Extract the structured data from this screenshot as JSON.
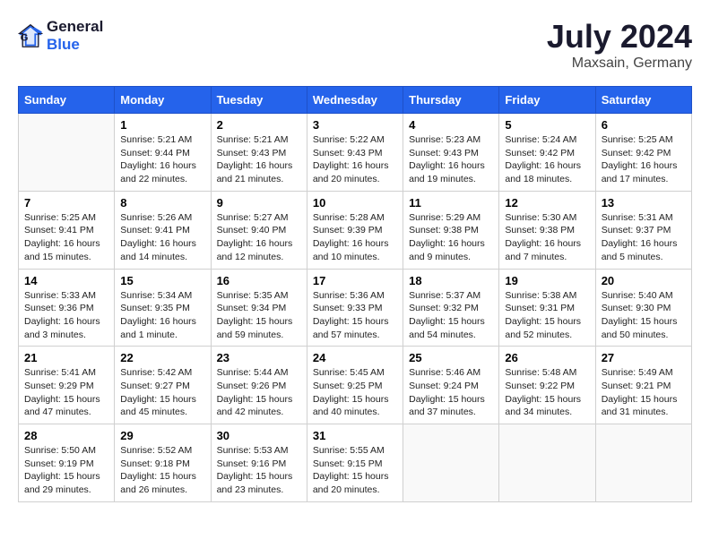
{
  "header": {
    "logo_line1": "General",
    "logo_line2": "Blue",
    "month": "July 2024",
    "location": "Maxsain, Germany"
  },
  "weekdays": [
    "Sunday",
    "Monday",
    "Tuesday",
    "Wednesday",
    "Thursday",
    "Friday",
    "Saturday"
  ],
  "weeks": [
    [
      {
        "day": "",
        "info": ""
      },
      {
        "day": "1",
        "info": "Sunrise: 5:21 AM\nSunset: 9:44 PM\nDaylight: 16 hours\nand 22 minutes."
      },
      {
        "day": "2",
        "info": "Sunrise: 5:21 AM\nSunset: 9:43 PM\nDaylight: 16 hours\nand 21 minutes."
      },
      {
        "day": "3",
        "info": "Sunrise: 5:22 AM\nSunset: 9:43 PM\nDaylight: 16 hours\nand 20 minutes."
      },
      {
        "day": "4",
        "info": "Sunrise: 5:23 AM\nSunset: 9:43 PM\nDaylight: 16 hours\nand 19 minutes."
      },
      {
        "day": "5",
        "info": "Sunrise: 5:24 AM\nSunset: 9:42 PM\nDaylight: 16 hours\nand 18 minutes."
      },
      {
        "day": "6",
        "info": "Sunrise: 5:25 AM\nSunset: 9:42 PM\nDaylight: 16 hours\nand 17 minutes."
      }
    ],
    [
      {
        "day": "7",
        "info": "Sunrise: 5:25 AM\nSunset: 9:41 PM\nDaylight: 16 hours\nand 15 minutes."
      },
      {
        "day": "8",
        "info": "Sunrise: 5:26 AM\nSunset: 9:41 PM\nDaylight: 16 hours\nand 14 minutes."
      },
      {
        "day": "9",
        "info": "Sunrise: 5:27 AM\nSunset: 9:40 PM\nDaylight: 16 hours\nand 12 minutes."
      },
      {
        "day": "10",
        "info": "Sunrise: 5:28 AM\nSunset: 9:39 PM\nDaylight: 16 hours\nand 10 minutes."
      },
      {
        "day": "11",
        "info": "Sunrise: 5:29 AM\nSunset: 9:38 PM\nDaylight: 16 hours\nand 9 minutes."
      },
      {
        "day": "12",
        "info": "Sunrise: 5:30 AM\nSunset: 9:38 PM\nDaylight: 16 hours\nand 7 minutes."
      },
      {
        "day": "13",
        "info": "Sunrise: 5:31 AM\nSunset: 9:37 PM\nDaylight: 16 hours\nand 5 minutes."
      }
    ],
    [
      {
        "day": "14",
        "info": "Sunrise: 5:33 AM\nSunset: 9:36 PM\nDaylight: 16 hours\nand 3 minutes."
      },
      {
        "day": "15",
        "info": "Sunrise: 5:34 AM\nSunset: 9:35 PM\nDaylight: 16 hours\nand 1 minute."
      },
      {
        "day": "16",
        "info": "Sunrise: 5:35 AM\nSunset: 9:34 PM\nDaylight: 15 hours\nand 59 minutes."
      },
      {
        "day": "17",
        "info": "Sunrise: 5:36 AM\nSunset: 9:33 PM\nDaylight: 15 hours\nand 57 minutes."
      },
      {
        "day": "18",
        "info": "Sunrise: 5:37 AM\nSunset: 9:32 PM\nDaylight: 15 hours\nand 54 minutes."
      },
      {
        "day": "19",
        "info": "Sunrise: 5:38 AM\nSunset: 9:31 PM\nDaylight: 15 hours\nand 52 minutes."
      },
      {
        "day": "20",
        "info": "Sunrise: 5:40 AM\nSunset: 9:30 PM\nDaylight: 15 hours\nand 50 minutes."
      }
    ],
    [
      {
        "day": "21",
        "info": "Sunrise: 5:41 AM\nSunset: 9:29 PM\nDaylight: 15 hours\nand 47 minutes."
      },
      {
        "day": "22",
        "info": "Sunrise: 5:42 AM\nSunset: 9:27 PM\nDaylight: 15 hours\nand 45 minutes."
      },
      {
        "day": "23",
        "info": "Sunrise: 5:44 AM\nSunset: 9:26 PM\nDaylight: 15 hours\nand 42 minutes."
      },
      {
        "day": "24",
        "info": "Sunrise: 5:45 AM\nSunset: 9:25 PM\nDaylight: 15 hours\nand 40 minutes."
      },
      {
        "day": "25",
        "info": "Sunrise: 5:46 AM\nSunset: 9:24 PM\nDaylight: 15 hours\nand 37 minutes."
      },
      {
        "day": "26",
        "info": "Sunrise: 5:48 AM\nSunset: 9:22 PM\nDaylight: 15 hours\nand 34 minutes."
      },
      {
        "day": "27",
        "info": "Sunrise: 5:49 AM\nSunset: 9:21 PM\nDaylight: 15 hours\nand 31 minutes."
      }
    ],
    [
      {
        "day": "28",
        "info": "Sunrise: 5:50 AM\nSunset: 9:19 PM\nDaylight: 15 hours\nand 29 minutes."
      },
      {
        "day": "29",
        "info": "Sunrise: 5:52 AM\nSunset: 9:18 PM\nDaylight: 15 hours\nand 26 minutes."
      },
      {
        "day": "30",
        "info": "Sunrise: 5:53 AM\nSunset: 9:16 PM\nDaylight: 15 hours\nand 23 minutes."
      },
      {
        "day": "31",
        "info": "Sunrise: 5:55 AM\nSunset: 9:15 PM\nDaylight: 15 hours\nand 20 minutes."
      },
      {
        "day": "",
        "info": ""
      },
      {
        "day": "",
        "info": ""
      },
      {
        "day": "",
        "info": ""
      }
    ]
  ]
}
